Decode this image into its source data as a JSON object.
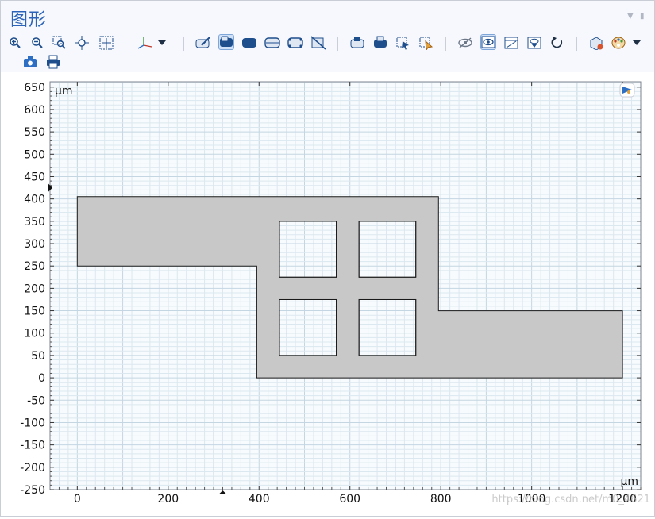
{
  "window": {
    "title": "图形"
  },
  "toolbar": {
    "row1": [
      "zoom-in-icon",
      "zoom-out-icon",
      "zoom-box-icon",
      "zoom-extents-icon",
      "fit-window-icon",
      "axis-orientation-icon",
      "dropdown-arrow-icon",
      "select-objects-icon",
      "select-domains-icon",
      "select-boundaries-icon",
      "select-edges-icon",
      "select-points-icon",
      "clear-selection-icon",
      "render-scene-icon",
      "render-wireframe-icon",
      "zoom-selected-icon",
      "transparency-icon",
      "hide-entities-icon",
      "show-all-icon",
      "view-selected-icon",
      "reset-hiding-icon",
      "reset-view-icon",
      "scene-light-icon",
      "color-palette-icon",
      "dropdown-arrow-icon"
    ],
    "row2": [
      "camera-icon",
      "print-icon"
    ]
  },
  "plot": {
    "unit_top": "μm",
    "unit_bottom": "μm",
    "y_ticks": [
      "650",
      "600",
      "550",
      "500",
      "450",
      "400",
      "350",
      "300",
      "250",
      "200",
      "150",
      "100",
      "50",
      "0",
      "-50",
      "-100",
      "-150",
      "-200",
      "-250"
    ],
    "x_ticks": [
      "0",
      "200",
      "400",
      "600",
      "800",
      "1000",
      "1200"
    ],
    "watermark": "https://blog.csdn.net/m0_4621",
    "colors": {
      "domain_fill": "#c8c8c8",
      "grid_minor": "#dbe8ef",
      "grid_major": "#c4d6e2",
      "edge": "#1a1a1a"
    }
  },
  "chart_data": {
    "type": "geometry",
    "title": "",
    "xlabel": "μm",
    "ylabel": "μm",
    "xlim": [
      -60,
      1240
    ],
    "ylim": [
      -250,
      662
    ],
    "outer_polygon": [
      [
        0,
        405
      ],
      [
        795,
        405
      ],
      [
        795,
        150
      ],
      [
        1200,
        150
      ],
      [
        1200,
        0
      ],
      [
        395,
        0
      ],
      [
        395,
        250
      ],
      [
        0,
        250
      ]
    ],
    "holes": [
      {
        "x0": 445,
        "y0": 225,
        "x1": 570,
        "y1": 350
      },
      {
        "x0": 620,
        "y0": 225,
        "x1": 745,
        "y1": 350
      },
      {
        "x0": 445,
        "y0": 50,
        "x1": 570,
        "y1": 175
      },
      {
        "x0": 620,
        "y0": 50,
        "x1": 745,
        "y1": 175
      }
    ],
    "grid": true
  }
}
